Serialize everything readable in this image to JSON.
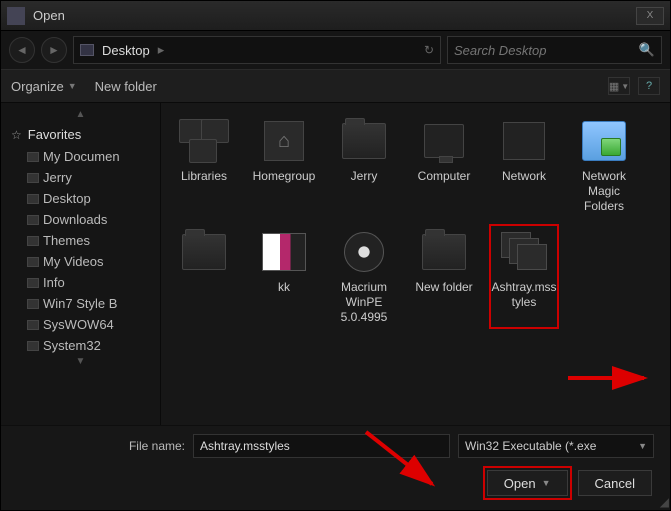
{
  "title": "Open",
  "winbtns": {
    "close": "X"
  },
  "nav": {
    "back": "◄",
    "fwd": "►"
  },
  "address": {
    "location": "Desktop",
    "sep": "▸"
  },
  "search": {
    "placeholder": "Search Desktop"
  },
  "toolbar": {
    "organize": "Organize",
    "newfolder": "New folder"
  },
  "sidebar": {
    "favorites": "Favorites",
    "items": [
      "My Documen",
      "Jerry",
      "Desktop",
      "Downloads",
      "Themes",
      "My Videos",
      "Info",
      "Win7 Style B",
      "SysWOW64",
      "System32"
    ]
  },
  "files": {
    "row1": [
      {
        "name": "Libraries"
      },
      {
        "name": "Homegroup"
      },
      {
        "name": "Jerry"
      },
      {
        "name": "Computer"
      },
      {
        "name": "Network"
      },
      {
        "name": "Network Magic Folders"
      }
    ],
    "row2": [
      {
        "name": ""
      },
      {
        "name": "kk"
      },
      {
        "name": "Macrium WinPE 5.0.4995"
      },
      {
        "name": "New folder"
      },
      {
        "name": "Ashtray.msstyles"
      }
    ]
  },
  "filename": {
    "label": "File name:",
    "value": "Ashtray.msstyles"
  },
  "filter": {
    "label": "Win32 Executable (*.exe"
  },
  "buttons": {
    "open": "Open",
    "cancel": "Cancel"
  }
}
